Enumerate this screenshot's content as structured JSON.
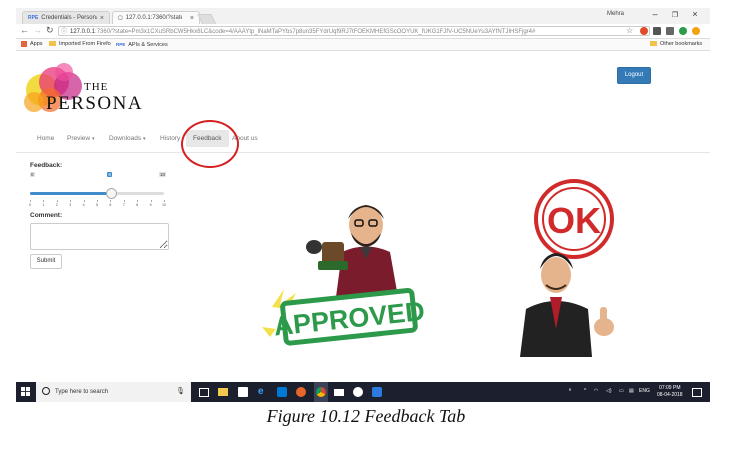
{
  "browser": {
    "tabs": [
      {
        "favicon": "RPE",
        "title": "Credentials - Personality"
      },
      {
        "favicon": "page-icon",
        "title": "127.0.0.1:7360/?state=P"
      }
    ],
    "user": "Mehra",
    "url_host": "127.0.0.1",
    "url_rest": ":7360/?state=Pm3x1CXuSRbCW5Hkx8LC&code=4/AAAYtp_lNaMTaPYbs7p8un35FYdrUqf9RJ7tFOEKMHEfGScOOYUK_fUKG1FJfV-UC5NUeYu3AYfNTJIHSFjgr4#",
    "bookmarks": [
      {
        "label": "Apps",
        "icon": "apps-grid"
      },
      {
        "label": "Imported From Firefo",
        "icon": "folder"
      },
      {
        "label": "APIs & Services",
        "icon": "rpe-icon"
      }
    ],
    "other_bookmarks": "Other bookmarks"
  },
  "header": {
    "logo_the": "THE",
    "logo_persona": "PERSONA",
    "logout_label": "Logout"
  },
  "navbar": {
    "items": [
      {
        "label": "Home",
        "dropdown": false
      },
      {
        "label": "Preview",
        "dropdown": true
      },
      {
        "label": "Downloads",
        "dropdown": true
      },
      {
        "label": "History",
        "dropdown": false
      },
      {
        "label": "Feedback",
        "dropdown": false,
        "active": true
      },
      {
        "label": "About us",
        "dropdown": false
      }
    ],
    "caret": "▾"
  },
  "feedback": {
    "label": "Feedback:",
    "min": 0,
    "max": 10,
    "value": 6,
    "min_label": "0",
    "max_label": "10",
    "value_label": "6",
    "ticks": [
      "0",
      "1",
      "2",
      "3",
      "4",
      "5",
      "6",
      "7",
      "8",
      "9",
      "10"
    ]
  },
  "comment": {
    "label": "Comment:",
    "value": ""
  },
  "submit_label": "Submit",
  "stickers": {
    "approved_text": "APPROVED",
    "ok_text": "OK"
  },
  "taskbar": {
    "search_placeholder": "Type here to search",
    "lang": "ENG",
    "time": "07:09 PM",
    "date": "08-04-2018"
  },
  "caption": "Figure 10.12 Feedback Tab",
  "colors": {
    "primary": "#337ab7",
    "highlight_circle": "#d42020",
    "stamp_green": "#2c9a4a",
    "stamp_red": "#d12a2a",
    "taskbar": "#1b1f2e"
  }
}
